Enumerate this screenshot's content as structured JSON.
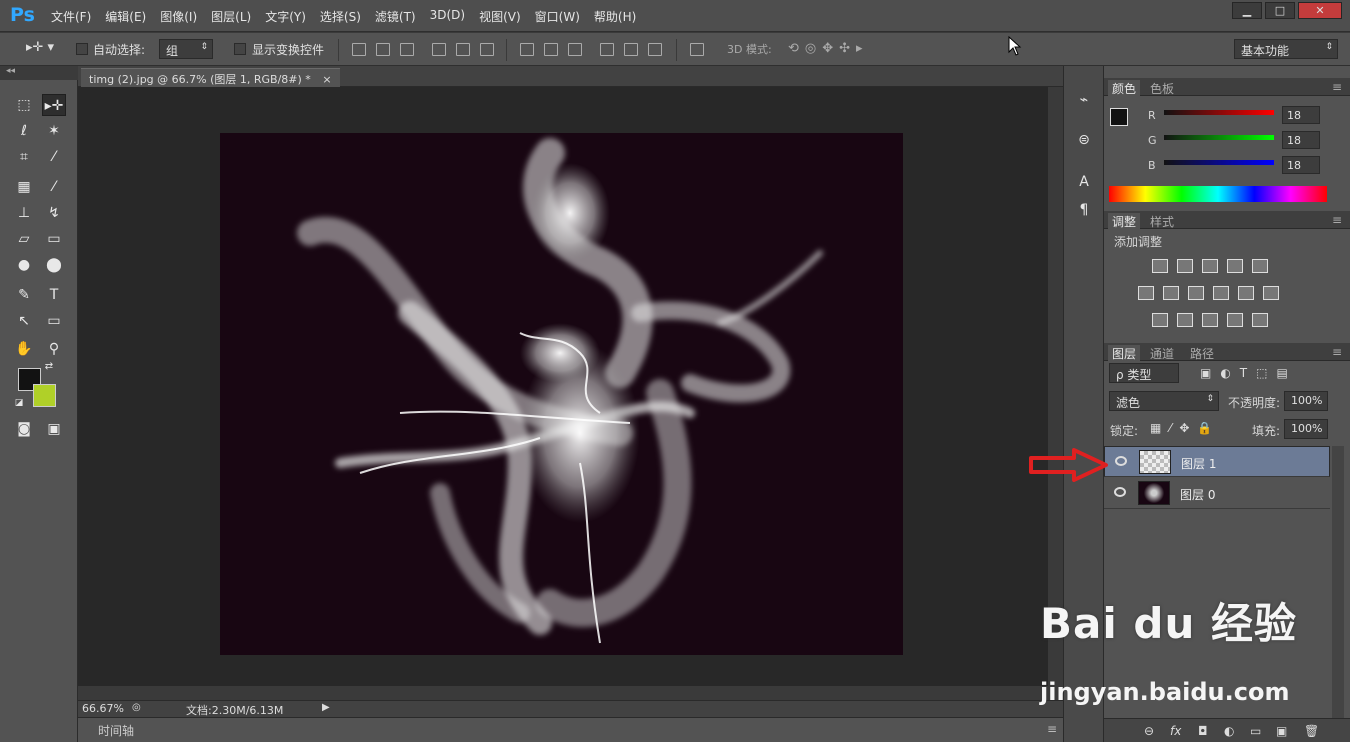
{
  "app": {
    "logo": "Ps"
  },
  "menu": [
    "文件(F)",
    "编辑(E)",
    "图像(I)",
    "图层(L)",
    "文字(Y)",
    "选择(S)",
    "滤镜(T)",
    "3D(D)",
    "视图(V)",
    "窗口(W)",
    "帮助(H)"
  ],
  "window_buttons": [
    "▁",
    "□",
    "✕"
  ],
  "options": {
    "auto_select_label": "自动选择:",
    "auto_select_value": "组",
    "show_transform_label": "显示变换控件",
    "mode_3d_label": "3D 模式:",
    "workspace_value": "基本功能"
  },
  "document": {
    "tab_title": "timg (2).jpg @ 66.7% (图层 1, RGB/8#) *",
    "tab_close": "×",
    "zoom": "66.67%",
    "doc_info": "文档:2.30M/6.13M",
    "timeline_label": "时间轴"
  },
  "color_panel": {
    "tabs": [
      "颜色",
      "色板"
    ],
    "r_label": "R",
    "g_label": "G",
    "b_label": "B",
    "r_value": "18",
    "g_value": "18",
    "b_value": "18",
    "fg_color": "#121212",
    "bg_color": "#b0d028"
  },
  "adjust_panel": {
    "tabs": [
      "调整",
      "样式"
    ],
    "title": "添加调整"
  },
  "layers_panel": {
    "tabs": [
      "图层",
      "通道",
      "路径"
    ],
    "filter_value": "ρ 类型",
    "blend_mode": "滤色",
    "opacity_label": "不透明度:",
    "opacity_value": "100%",
    "lock_label": "锁定:",
    "fill_label": "填充:",
    "fill_value": "100%",
    "layers": [
      {
        "name": "图层 1",
        "selected": true
      },
      {
        "name": "图层 0",
        "selected": false
      }
    ],
    "bottom_icons": [
      "⊖",
      "fx",
      "◘",
      "◐",
      "▭",
      "▣",
      "🗑"
    ]
  },
  "watermark": {
    "brand": "Bai du 经验",
    "url": "jingyan.baidu.com"
  }
}
